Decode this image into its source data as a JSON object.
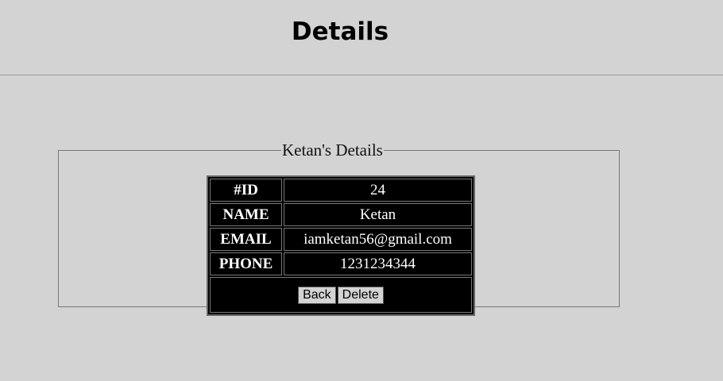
{
  "header": {
    "title": "Details"
  },
  "details": {
    "legend": "Ketan's Details",
    "rows": [
      {
        "label": "#ID",
        "value": "24"
      },
      {
        "label": "NAME",
        "value": "Ketan"
      },
      {
        "label": "EMAIL",
        "value": "iamketan56@gmail.com"
      },
      {
        "label": "PHONE",
        "value": "1231234344"
      }
    ],
    "back_label": "Back",
    "delete_label": "Delete"
  }
}
